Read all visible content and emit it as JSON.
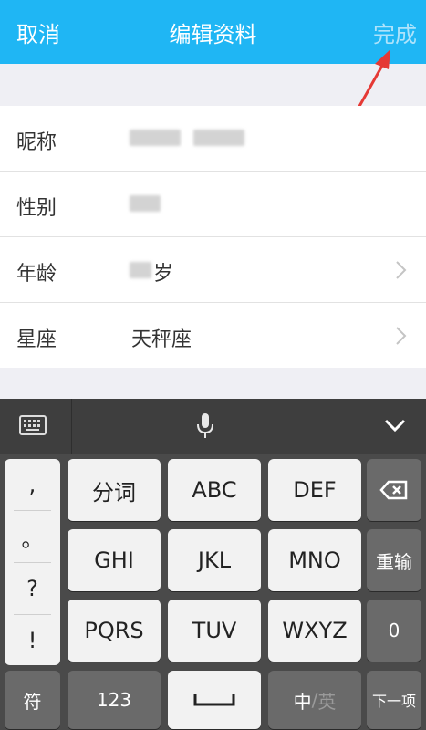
{
  "header": {
    "cancel": "取消",
    "title": "编辑资料",
    "done": "完成"
  },
  "form": {
    "nickname_label": "昵称",
    "gender_label": "性别",
    "age_label": "年龄",
    "age_suffix": "岁",
    "zodiac_label": "星座",
    "zodiac_value": "天秤座"
  },
  "keyboard": {
    "punct": [
      ",",
      "。",
      "?",
      "!"
    ],
    "row1": [
      "分词",
      "ABC",
      "DEF"
    ],
    "row2": [
      "GHI",
      "JKL",
      "MNO"
    ],
    "row3": [
      "PQRS",
      "TUV",
      "WXYZ"
    ],
    "reenter": "重输",
    "zero": "0",
    "symbols": "符",
    "num": "123",
    "zh": "中",
    "slash": "/",
    "en": "英",
    "next": "下一项"
  },
  "colors": {
    "header": "#1fb6f4",
    "arrow": "#e53935"
  }
}
